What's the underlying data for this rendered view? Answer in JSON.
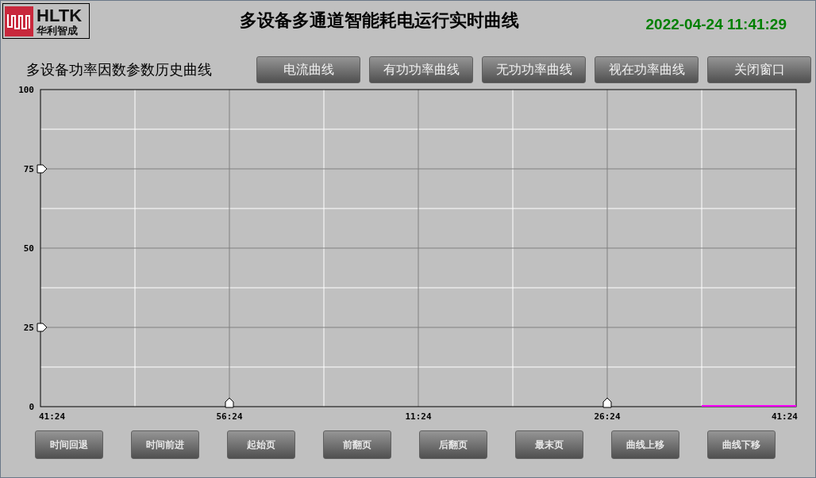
{
  "logo": {
    "name": "HLTK",
    "subtitle": "华利智成"
  },
  "title": "多设备多通道智能耗电运行实时曲线",
  "datetime": "2022-04-24 11:41:29",
  "subtitle": "多设备功率因数参数历史曲线",
  "top_buttons": [
    "电流曲线",
    "有功功率曲线",
    "无功功率曲线",
    "视在功率曲线",
    "关闭窗口"
  ],
  "chart_data": {
    "type": "line",
    "grid": true,
    "categories": [
      "41:24",
      null,
      "56:24",
      null,
      "11:24",
      null,
      "26:24",
      null,
      "41:24"
    ],
    "series": [
      {
        "color": "#ff00ff",
        "values": [
          null,
          null,
          null,
          null,
          null,
          null,
          null,
          0,
          0
        ]
      }
    ],
    "ylim": [
      0,
      100
    ],
    "yticks": [
      0,
      25,
      50,
      75,
      100
    ]
  },
  "bottom_buttons": [
    "时间回退",
    "时间前进",
    "起始页",
    "前翻页",
    "后翻页",
    "最末页",
    "曲线上移",
    "曲线下移"
  ]
}
